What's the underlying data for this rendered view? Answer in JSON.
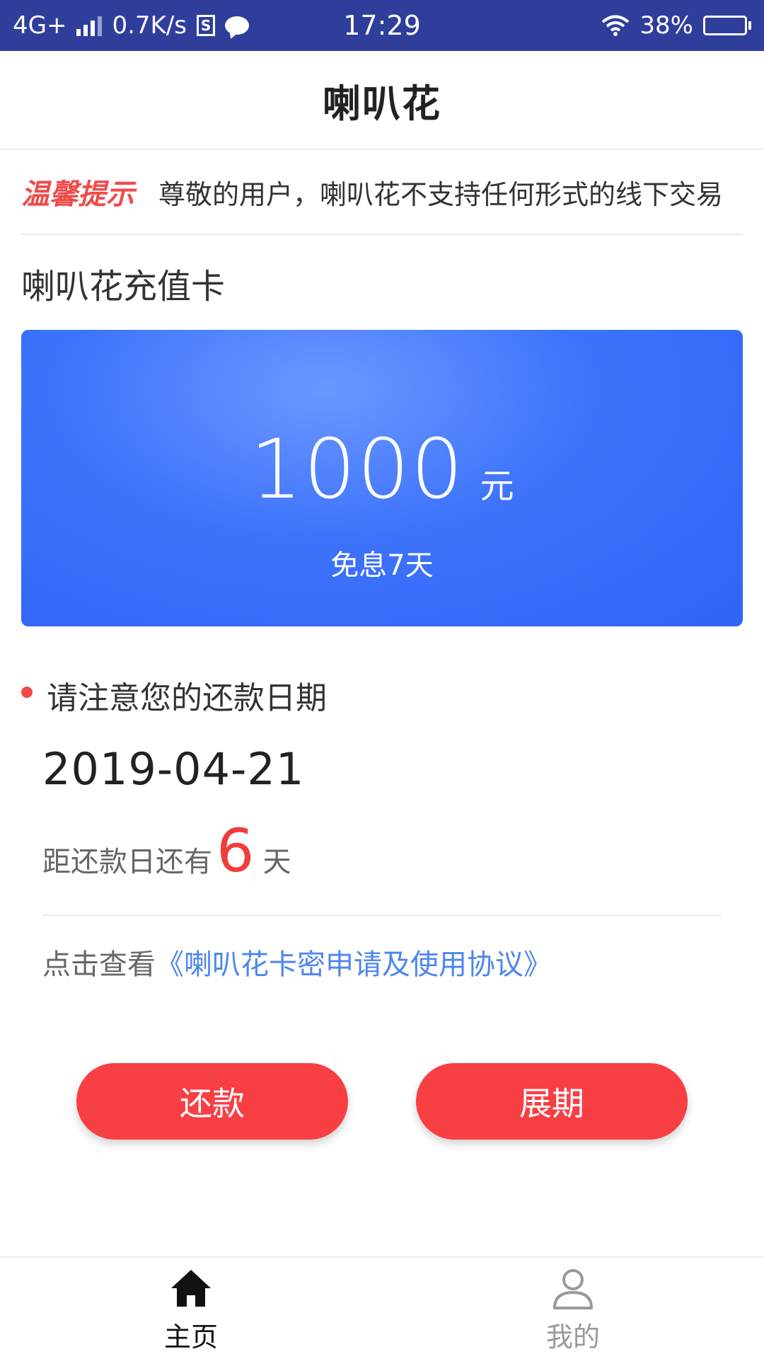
{
  "status_bar": {
    "network": "4G+",
    "speed": "0.7K/s",
    "sim_badge": "S",
    "time": "17:29",
    "battery": "38%",
    "battery_level": 0.38
  },
  "header": {
    "title": "喇叭花"
  },
  "notice": {
    "tag": "温馨提示",
    "text": "尊敬的用户，喇叭花不支持任何形式的线下交易"
  },
  "card_section": {
    "title": "喇叭花充值卡",
    "amount": "1000",
    "unit": "元",
    "subtitle": "免息7天"
  },
  "repayment": {
    "title": "请注意您的还款日期",
    "due_date": "2019-04-21",
    "countdown_prefix": "距还款日还有",
    "days": "6",
    "countdown_suffix": "天",
    "agreement_prefix": "点击查看",
    "agreement_link": "《喇叭花卡密申请及使用协议》"
  },
  "actions": {
    "repay": "还款",
    "extend": "展期"
  },
  "bottom_nav": {
    "home": "主页",
    "mine": "我的"
  },
  "colors": {
    "status_bar": "#2f3e9b",
    "accent_red": "#f73f44",
    "card_blue": "#3d73fb",
    "link_blue": "#4d86ee"
  }
}
